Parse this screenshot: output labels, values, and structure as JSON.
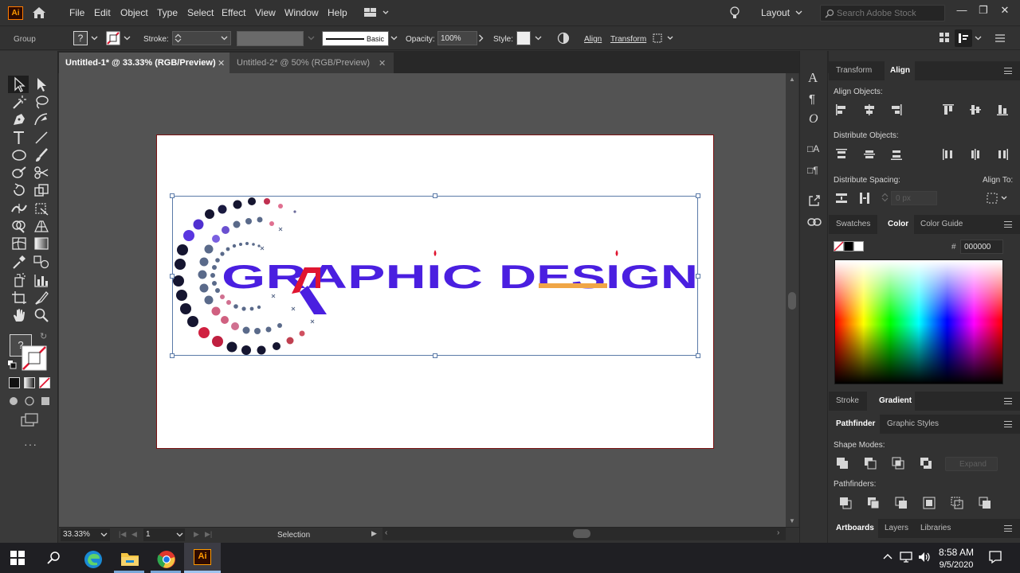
{
  "menubar": {
    "app_logo": "Ai",
    "items": [
      "File",
      "Edit",
      "Object",
      "Type",
      "Select",
      "Effect",
      "View",
      "Window",
      "Help"
    ],
    "workspace": "Layout",
    "search_placeholder": "Search Adobe Stock"
  },
  "control": {
    "selection_type": "Group",
    "stroke_label": "Stroke:",
    "brush_label": "Basic",
    "opacity_label": "Opacity:",
    "opacity_value": "100%",
    "style_label": "Style:",
    "align_label": "Align",
    "transform_label": "Transform"
  },
  "tabs": [
    {
      "label": "Untitled-1* @ 33.33% (RGB/Preview)",
      "active": true
    },
    {
      "label": "Untitled-2* @ 50% (RGB/Preview)",
      "active": false
    }
  ],
  "artwork": {
    "text_part1": "GRAPHIC",
    "text_part2": "DESIGN"
  },
  "status": {
    "zoom": "33.33%",
    "artboard_number": "1",
    "tool": "Selection"
  },
  "panels": {
    "top_tabs": [
      "Transform",
      "Align"
    ],
    "align_objects": "Align Objects:",
    "distribute_objects": "Distribute Objects:",
    "distribute_spacing": "Distribute Spacing:",
    "spacing_value": "0 px",
    "align_to": "Align To:",
    "color_tabs": [
      "Swatches",
      "Color",
      "Color Guide"
    ],
    "hex_value": "000000",
    "stroke_tabs": [
      "Stroke",
      "Gradient"
    ],
    "pathfinder_tabs": [
      "Pathfinder",
      "Graphic Styles"
    ],
    "shape_modes": "Shape Modes:",
    "expand": "Expand",
    "pathfinders": "Pathfinders:",
    "bottom_tabs": [
      "Artboards",
      "Layers",
      "Libraries"
    ]
  },
  "taskbar": {
    "time": "8:58 AM",
    "date": "9/5/2020"
  },
  "colors": {
    "accent_blue": "#4a1fe0",
    "accent_red": "#e01530",
    "accent_orange": "#f0a646"
  }
}
